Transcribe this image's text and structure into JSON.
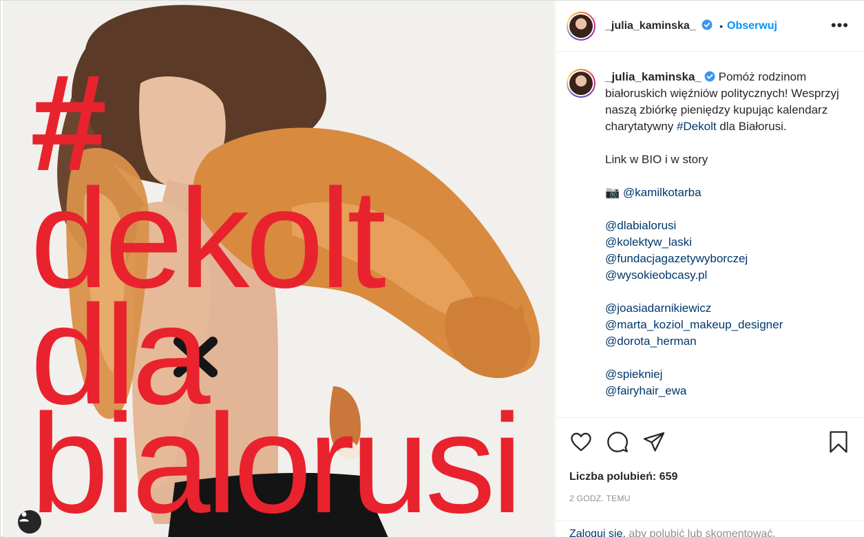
{
  "post": {
    "overlay_text": {
      "hash": "#",
      "line1": "dekolt",
      "line2": "dla",
      "line3": "bialorusi"
    },
    "tag_icon": "user-tag-icon"
  },
  "header": {
    "username": "_julia_kaminska_",
    "separator": "•",
    "follow_label": "Obserwuj",
    "more_label": "•••"
  },
  "caption": {
    "username": "_julia_kaminska_",
    "text_1": "Pomóż rodzinom białoruskich więźniów politycznych! Wesprzyj naszą zbiórkę pieniędzy kupując kalendarz charytatywny ",
    "hashtag": "#Dekolt",
    "text_2": " dla Białorusi.",
    "bio_line": "Link w BIO i w story",
    "camera_emoji": "📷",
    "photographer": "@kamilkotarba",
    "mentions_group1": [
      "@dlabialorusi",
      "@kolektyw_laski",
      "@fundacjagazetywyborczej",
      "@wysokieobcasy.pl"
    ],
    "mentions_group2": [
      "@joasiadarnikiewicz",
      "@marta_koziol_makeup_designer",
      "@dorota_herman"
    ],
    "mentions_group3": [
      "@spiekniej",
      "@fairyhair_ewa"
    ]
  },
  "actions": {
    "like_icon": "heart-icon",
    "comment_icon": "comment-icon",
    "share_icon": "share-icon",
    "save_icon": "bookmark-icon"
  },
  "likes_text": "Liczba polubień: 659",
  "time_text": "2 GODZ. TEMU",
  "login": {
    "link": "Zaloguj się,",
    "rest": " aby polubić lub skomentować."
  },
  "colors": {
    "accent_blue": "#0095f6",
    "link_blue": "#00376b",
    "overlay_red": "#e8232e",
    "verified_blue": "#3897f0"
  }
}
